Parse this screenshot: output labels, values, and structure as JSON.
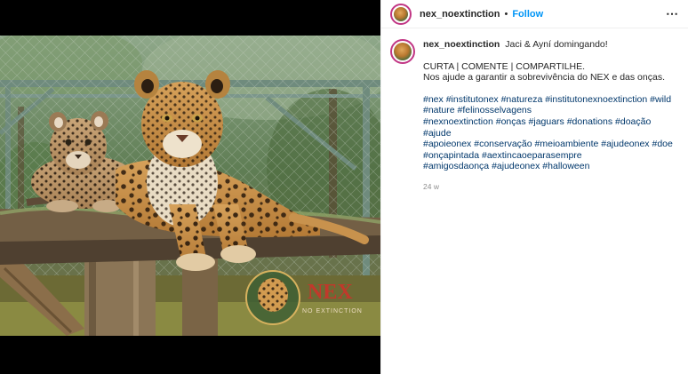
{
  "post": {
    "username": "nex_noextinction",
    "follow_label": "Follow",
    "more_icon": "more-horizontal-icon",
    "caption_title": "Jaci & Ayní domingando!",
    "caption_line1": "CURTA | COMENTE | COMPARTILHE.",
    "caption_line2": "Nos ajude a garantir a sobrevivência do NEX e das onças.",
    "hashtags": [
      "#nex",
      "#institutonex",
      "#natureza",
      "#institutonexnoextinction",
      "#wild",
      "#nature",
      "#felinosselvagens",
      "#nexnoextinction",
      "#onças",
      "#jaguars",
      "#donations",
      "#doação",
      "#ajude",
      "#apoieonex",
      "#conservação",
      "#meioambiente",
      "#ajudeonex",
      "#doe",
      "#onçapintada",
      "#aextincaoeparasempre",
      "#amigosdaonça",
      "#ajudeonex",
      "#halloween"
    ],
    "timestamp": "24 w"
  },
  "image": {
    "watermark_text": "NEX",
    "watermark_sub": "NO EXTINCTION",
    "accent": "#c0392b"
  },
  "colors": {
    "link": "#00376b",
    "follow": "#0095f6",
    "text": "#262626",
    "muted": "#8e8e8e"
  }
}
